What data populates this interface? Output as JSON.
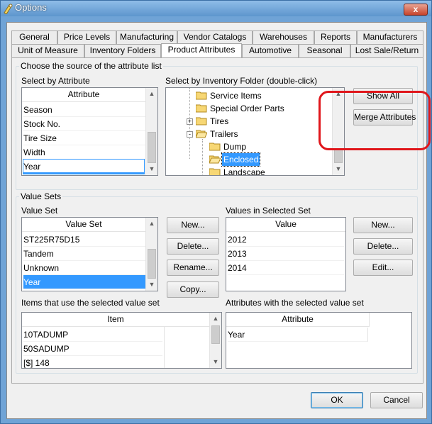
{
  "window": {
    "title": "Options",
    "close_label": "x"
  },
  "tabs_row1": [
    "General",
    "Price Levels",
    "Manufacturing",
    "Vendor Catalogs",
    "Warehouses",
    "Reports",
    "Manufacturers"
  ],
  "tabs_row2": [
    "Unit of Measure",
    "Inventory Folders",
    "Product Attributes",
    "Automotive",
    "Seasonal",
    "Lost Sale/Return"
  ],
  "active_tab": "Product Attributes",
  "source_group": {
    "caption": "Choose the source of the attribute list",
    "select_by_attribute_label": "Select by Attribute",
    "attribute_header": "Attribute",
    "attributes": [
      "Season",
      "Stock No.",
      "Tire Size",
      "Width",
      "Year"
    ],
    "select_by_folder_label": "Select by Inventory Folder (double-click)",
    "folders": [
      {
        "name": "Service Items",
        "expander": ""
      },
      {
        "name": "Special Order Parts",
        "expander": ""
      },
      {
        "name": "Tires",
        "expander": "+"
      },
      {
        "name": "Trailers",
        "expander": "-"
      },
      {
        "name": "Dump",
        "expander": ""
      },
      {
        "name": "Enclosed",
        "expander": ""
      },
      {
        "name": "Landscape",
        "expander": ""
      }
    ],
    "selected_folder": "Enclosed",
    "show_all_label": "Show All",
    "merge_attributes_label": "Merge Attributes"
  },
  "value_sets_group": {
    "caption": "Value Sets",
    "value_set_label": "Value Set",
    "value_set_header": "Value Set",
    "value_sets": [
      "ST225R75D15",
      "Tandem",
      "Unknown",
      "Year"
    ],
    "selected_value_set": "Year",
    "new_label": "New...",
    "delete_label": "Delete...",
    "rename_label": "Rename...",
    "copy_label": "Copy...",
    "values_label": "Values in Selected Set",
    "value_header": "Value",
    "values": [
      "2012",
      "2013",
      "2014"
    ],
    "values_new_label": "New...",
    "values_delete_label": "Delete...",
    "values_edit_label": "Edit...",
    "items_label": "Items that use the selected value set",
    "item_header": "Item",
    "items": [
      "10TADUMP",
      "50SADUMP",
      "[$] 148"
    ],
    "attributes_label": "Attributes with the selected value set",
    "attributes_header": "Attribute",
    "attributes_with_set": [
      "Year"
    ]
  },
  "footer": {
    "ok_label": "OK",
    "cancel_label": "Cancel"
  },
  "colors": {
    "selection": "#3399ff",
    "annotation": "#e0161b",
    "title_bar": "#6fa3d6"
  }
}
